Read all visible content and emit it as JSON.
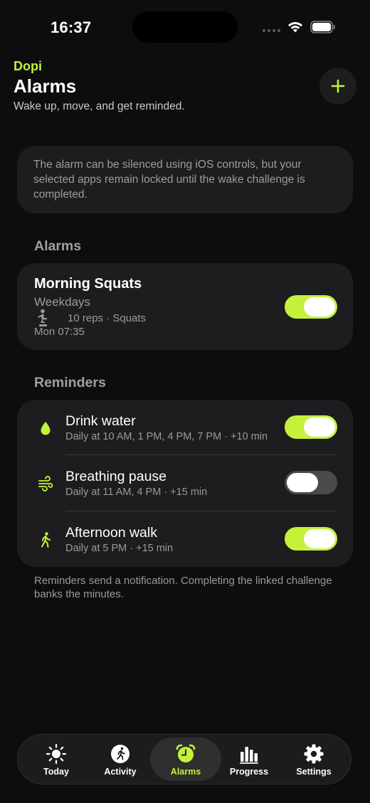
{
  "status_bar": {
    "time": "16:37"
  },
  "header": {
    "brand": "Dopi",
    "title": "Alarms",
    "subtitle": "Wake up, move, and get reminded.",
    "add_icon": "plus-icon"
  },
  "info": {
    "text": "The alarm can be silenced using iOS controls, but your selected apps remain locked until the wake challenge is completed."
  },
  "alarms_section": {
    "title": "Alarms",
    "items": [
      {
        "name": "Morning Squats",
        "days": "Weekdays",
        "icon": "squat-icon",
        "detail": "10 reps · Squats",
        "next": "Mon 07:35",
        "enabled": true
      }
    ]
  },
  "reminders_section": {
    "title": "Reminders",
    "items": [
      {
        "name": "Drink water",
        "schedule": "Daily at 10 AM, 1 PM, 4 PM, 7 PM · +10 min",
        "icon": "water-drop-icon",
        "enabled": true
      },
      {
        "name": "Breathing pause",
        "schedule": "Daily at 11 AM, 4 PM · +15 min",
        "icon": "wind-icon",
        "enabled": false
      },
      {
        "name": "Afternoon walk",
        "schedule": "Daily at 5 PM · +15 min",
        "icon": "walk-icon",
        "enabled": true
      }
    ],
    "footnote": "Reminders send a notification. Completing the linked challenge banks the minutes."
  },
  "tab_bar": {
    "tabs": [
      {
        "label": "Today",
        "icon": "sun-icon",
        "active": false
      },
      {
        "label": "Activity",
        "icon": "activity-icon",
        "active": false
      },
      {
        "label": "Alarms",
        "icon": "alarm-clock-icon",
        "active": true
      },
      {
        "label": "Progress",
        "icon": "bar-chart-icon",
        "active": false
      },
      {
        "label": "Settings",
        "icon": "gear-icon",
        "active": false
      }
    ]
  },
  "colors": {
    "accent": "#c4f23a",
    "background": "#0c0d0c",
    "card": "#1d1d1f",
    "secondary_text": "#9a9a9a"
  }
}
